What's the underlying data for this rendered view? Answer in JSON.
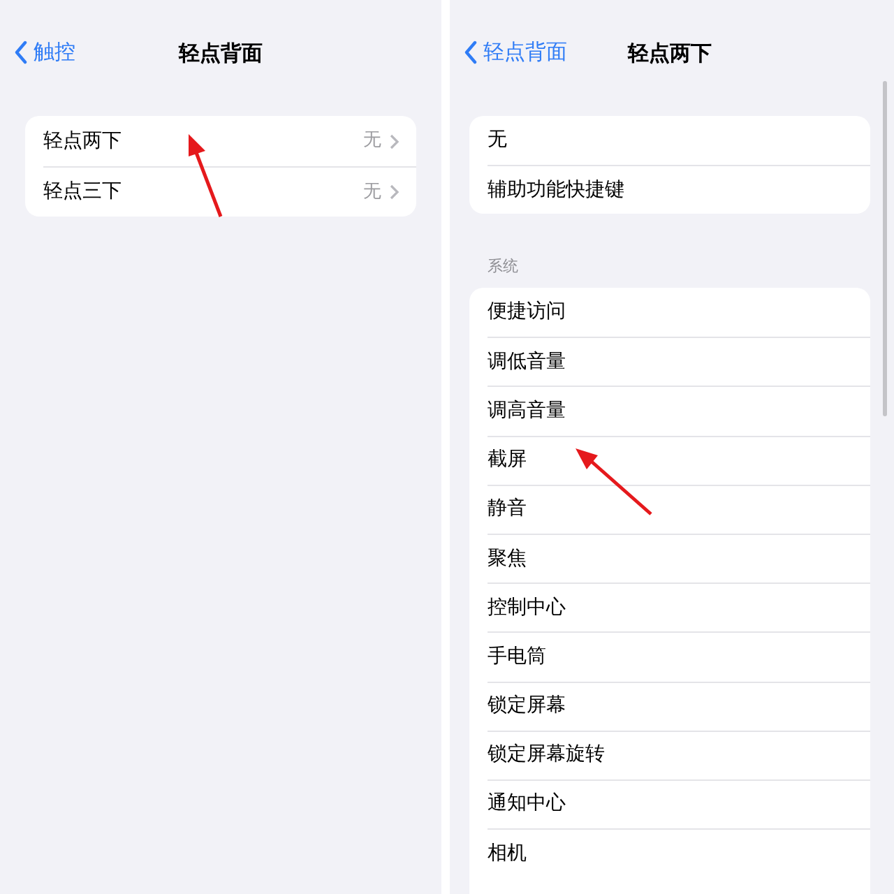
{
  "left": {
    "back": "触控",
    "title": "轻点背面",
    "rows": [
      {
        "label": "轻点两下",
        "value": "无"
      },
      {
        "label": "轻点三下",
        "value": "无"
      }
    ]
  },
  "right": {
    "back": "轻点背面",
    "title": "轻点两下",
    "top_rows": [
      "无",
      "辅助功能快捷键"
    ],
    "section": "系统",
    "system_rows": [
      "便捷访问",
      "调低音量",
      "调高音量",
      "截屏",
      "静音",
      "聚焦",
      "控制中心",
      "手电筒",
      "锁定屏幕",
      "锁定屏幕旋转",
      "通知中心",
      "相机"
    ]
  }
}
